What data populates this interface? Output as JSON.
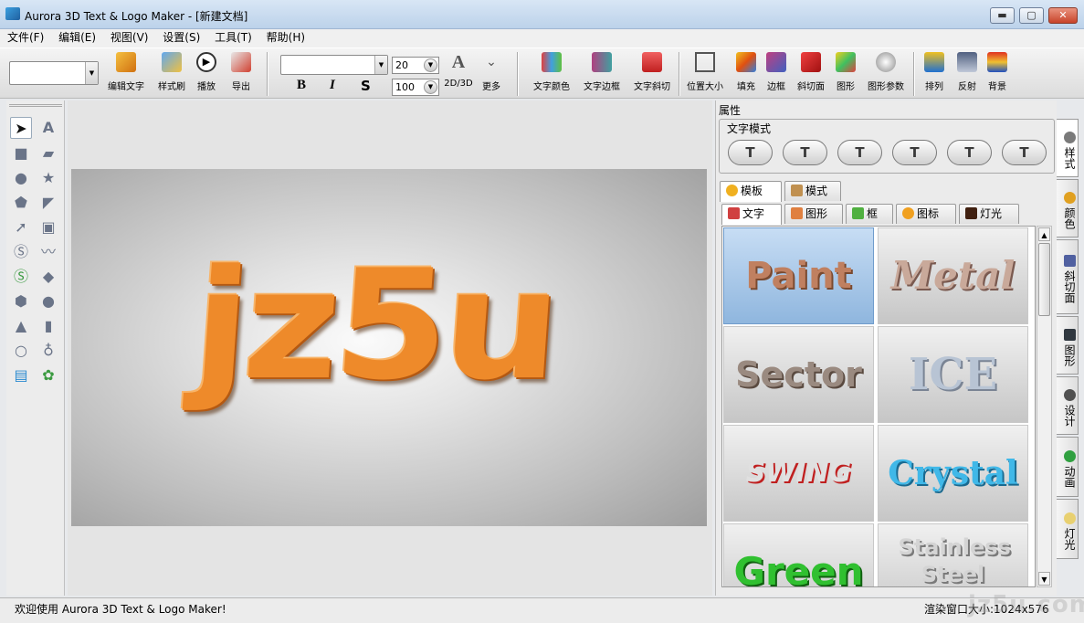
{
  "window": {
    "title": "Aurora 3D Text & Logo Maker - [新建文档]",
    "minimize": "▬",
    "maximize": "▢",
    "close": "✕"
  },
  "menu": [
    "文件(F)",
    "编辑(E)",
    "视图(V)",
    "设置(S)",
    "工具(T)",
    "帮助(H)"
  ],
  "toolbar": {
    "edit_text": "编辑文字",
    "style_brush": "样式刷",
    "play": "播放",
    "export": "导出",
    "bold": "B",
    "italic": "I",
    "strike": "S",
    "size1": "20",
    "size2": "100",
    "mode_2d3d": "2D/3D",
    "more": "更多",
    "text_color": "文字颜色",
    "text_border": "文字边框",
    "text_bevel": "文字斜切",
    "position_size": "位置大小",
    "fill": "填充",
    "frame": "边框",
    "bevel_face": "斜切面",
    "shape": "图形",
    "shape_params": "图形参数",
    "arrange": "排列",
    "reflect": "反射",
    "background": "背景"
  },
  "canvas": {
    "logo_text": "jz5u",
    "logo_color": "#ee8a2a"
  },
  "properties": {
    "title": "属性",
    "text_mode_label": "文字模式",
    "modes": [
      "T",
      "T",
      "T",
      "T",
      "T",
      "T"
    ],
    "top_tabs": [
      "模板",
      "模式"
    ],
    "sub_tabs": [
      "文字",
      "图形",
      "框",
      "图标",
      "灯光"
    ],
    "templates": [
      "Paint",
      "Metal",
      "Sector",
      "ICE",
      "SWING",
      "Crystal",
      "Green",
      "Stainless Steel"
    ]
  },
  "side_tabs": [
    "样式",
    "颜色",
    "斜切面",
    "图形",
    "设计",
    "动画",
    "灯光"
  ],
  "status": {
    "left": "欢迎使用 Aurora 3D Text & Logo Maker!",
    "right": "渲染窗口大小:1024x576",
    "watermark": "jz5u.com"
  }
}
